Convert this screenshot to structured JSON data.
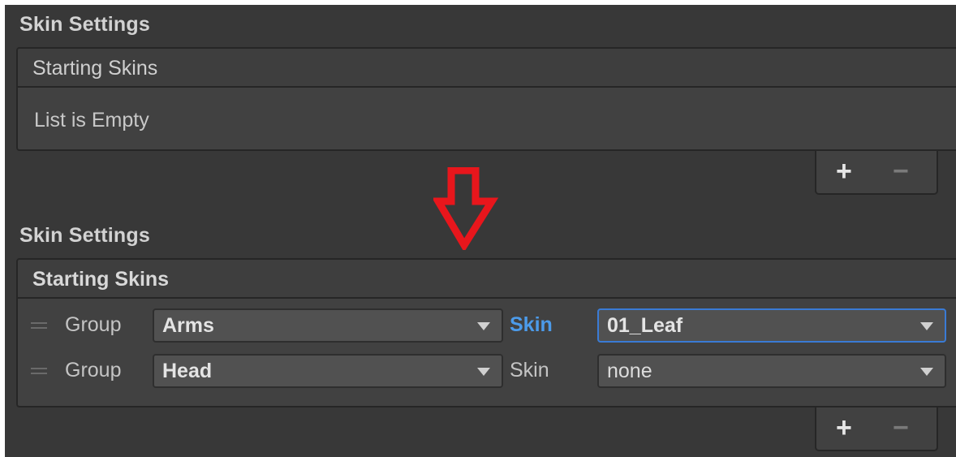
{
  "before": {
    "section_title": "Skin Settings",
    "list_header": "Starting Skins",
    "empty_text": "List is Empty",
    "add_symbol": "+",
    "remove_symbol": "−"
  },
  "after": {
    "section_title": "Skin Settings",
    "list_header": "Starting Skins",
    "add_symbol": "+",
    "remove_symbol": "−",
    "rows": [
      {
        "group_label": "Group",
        "group_value": "Arms",
        "skin_label": "Skin",
        "skin_value": "01_Leaf",
        "focused": true
      },
      {
        "group_label": "Group",
        "group_value": "Head",
        "skin_label": "Skin",
        "skin_value": "none",
        "focused": false
      }
    ]
  },
  "icons": {
    "transition_arrow": "down-arrow-icon",
    "transition_arrow_color": "#e8161c",
    "accent_color": "#3a7bd5"
  }
}
